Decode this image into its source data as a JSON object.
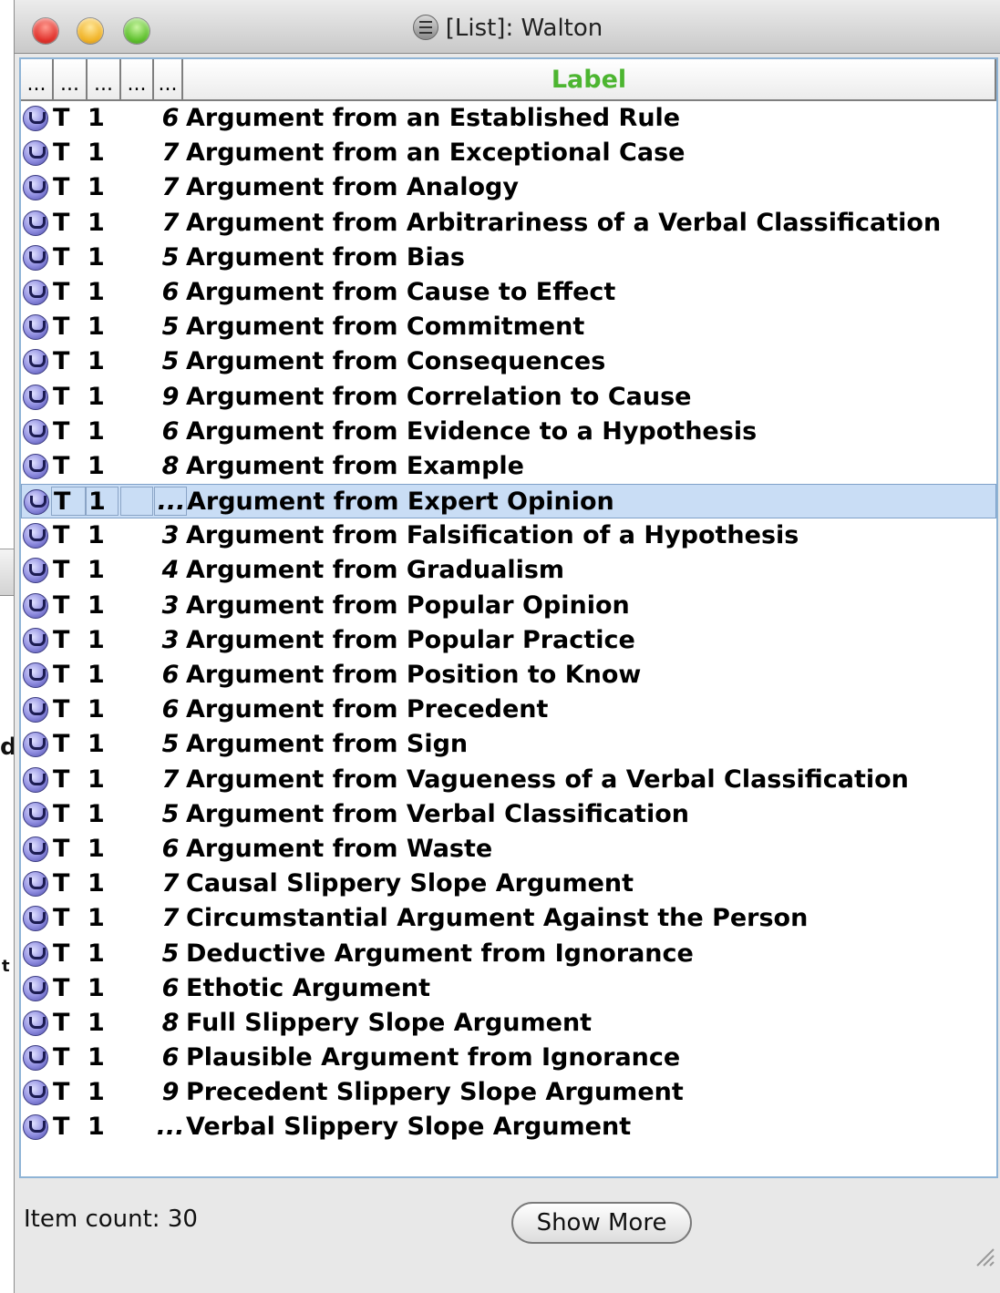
{
  "window": {
    "title": "[List]: Walton"
  },
  "table": {
    "headers": [
      "...",
      "...",
      "...",
      "...",
      "..."
    ],
    "label_header": "Label",
    "rows": [
      {
        "col1": "T",
        "col2": "1",
        "col4": "6",
        "label": "Argument from an Established Rule"
      },
      {
        "col1": "T",
        "col2": "1",
        "col4": "7",
        "label": "Argument from an Exceptional Case"
      },
      {
        "col1": "T",
        "col2": "1",
        "col4": "7",
        "label": "Argument from Analogy"
      },
      {
        "col1": "T",
        "col2": "1",
        "col4": "7",
        "label": "Argument from Arbitrariness of a Verbal Classification"
      },
      {
        "col1": "T",
        "col2": "1",
        "col4": "5",
        "label": "Argument from Bias"
      },
      {
        "col1": "T",
        "col2": "1",
        "col4": "6",
        "label": "Argument from Cause to Effect"
      },
      {
        "col1": "T",
        "col2": "1",
        "col4": "5",
        "label": "Argument from Commitment"
      },
      {
        "col1": "T",
        "col2": "1",
        "col4": "5",
        "label": "Argument from Consequences"
      },
      {
        "col1": "T",
        "col2": "1",
        "col4": "9",
        "label": "Argument from Correlation to Cause"
      },
      {
        "col1": "T",
        "col2": "1",
        "col4": "6",
        "label": "Argument from Evidence to a Hypothesis"
      },
      {
        "col1": "T",
        "col2": "1",
        "col4": "8",
        "label": "Argument from Example"
      },
      {
        "col1": "T",
        "col2": "1",
        "col4": "...",
        "label": "Argument from Expert Opinion",
        "selected": true
      },
      {
        "col1": "T",
        "col2": "1",
        "col4": "3",
        "label": "Argument from Falsification of a Hypothesis"
      },
      {
        "col1": "T",
        "col2": "1",
        "col4": "4",
        "label": "Argument from Gradualism"
      },
      {
        "col1": "T",
        "col2": "1",
        "col4": "3",
        "label": "Argument from Popular Opinion"
      },
      {
        "col1": "T",
        "col2": "1",
        "col4": "3",
        "label": "Argument from Popular Practice"
      },
      {
        "col1": "T",
        "col2": "1",
        "col4": "6",
        "label": "Argument from Position to Know"
      },
      {
        "col1": "T",
        "col2": "1",
        "col4": "6",
        "label": "Argument from Precedent"
      },
      {
        "col1": "T",
        "col2": "1",
        "col4": "5",
        "label": "Argument from Sign"
      },
      {
        "col1": "T",
        "col2": "1",
        "col4": "7",
        "label": "Argument from Vagueness of a Verbal Classification"
      },
      {
        "col1": "T",
        "col2": "1",
        "col4": "5",
        "label": "Argument from Verbal Classification"
      },
      {
        "col1": "T",
        "col2": "1",
        "col4": "6",
        "label": "Argument from Waste"
      },
      {
        "col1": "T",
        "col2": "1",
        "col4": "7",
        "label": "Causal Slippery Slope Argument"
      },
      {
        "col1": "T",
        "col2": "1",
        "col4": "7",
        "label": "Circumstantial Argument Against the Person"
      },
      {
        "col1": "T",
        "col2": "1",
        "col4": "5",
        "label": "Deductive Argument from Ignorance"
      },
      {
        "col1": "T",
        "col2": "1",
        "col4": "6",
        "label": "Ethotic Argument"
      },
      {
        "col1": "T",
        "col2": "1",
        "col4": "8",
        "label": "Full Slippery Slope Argument"
      },
      {
        "col1": "T",
        "col2": "1",
        "col4": "6",
        "label": "Plausible Argument from Ignorance"
      },
      {
        "col1": "T",
        "col2": "1",
        "col4": "9",
        "label": "Precedent Slippery Slope Argument"
      },
      {
        "col1": "T",
        "col2": "1",
        "col4": "...",
        "label": "Verbal Slippery Slope Argument"
      }
    ]
  },
  "footer": {
    "item_count": "Item count: 30",
    "show_more_label": "Show More"
  },
  "background_window": {
    "fragment_1": "d",
    "fragment_2": "t"
  },
  "colors": {
    "label_header": "#4cb530",
    "selection": "#c9ddf5",
    "table_border": "#8fb4d6"
  }
}
